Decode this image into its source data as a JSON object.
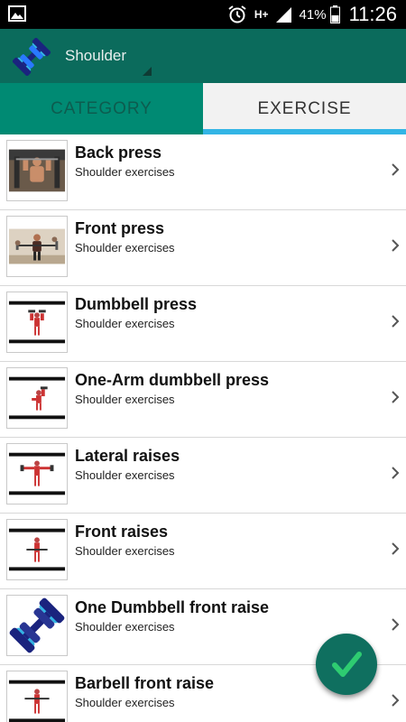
{
  "status_bar": {
    "network": "H+",
    "battery_percent": "41%",
    "time": "11:26",
    "icons": [
      "gallery-icon",
      "alarm-icon",
      "signal-icon",
      "battery-icon"
    ]
  },
  "app_bar": {
    "selected_category": "Shoulder",
    "logo_icon": "dumbbell-logo-icon",
    "color": "#0b6b5c"
  },
  "tabs": [
    {
      "label": "CATEGORY",
      "selected": false
    },
    {
      "label": "EXERCISE",
      "selected": true
    }
  ],
  "exercises": [
    {
      "title": "Back press",
      "subtitle": "Shoulder exercises",
      "thumb": "photo-gym"
    },
    {
      "title": "Front press",
      "subtitle": "Shoulder exercises",
      "thumb": "photo-barbell"
    },
    {
      "title": "Dumbbell press",
      "subtitle": "Shoulder exercises",
      "thumb": "figure-dumbbell-press"
    },
    {
      "title": "One-Arm dumbbell press",
      "subtitle": "Shoulder exercises",
      "thumb": "figure-one-arm-press"
    },
    {
      "title": "Lateral raises",
      "subtitle": "Shoulder exercises",
      "thumb": "figure-lateral-raise"
    },
    {
      "title": "Front raises",
      "subtitle": "Shoulder exercises",
      "thumb": "figure-front-raise"
    },
    {
      "title": "One Dumbbell front raise",
      "subtitle": "Shoulder exercises",
      "thumb": "dumbbell-logo"
    },
    {
      "title": "Barbell front raise",
      "subtitle": "Shoulder exercises",
      "thumb": "figure-barbell-raise"
    }
  ],
  "fab": {
    "icon": "checkmark-icon",
    "color": "#0f6f5f",
    "accent": "#2ecc71"
  },
  "colors": {
    "tab_indicator": "#33b5e5",
    "category_tab": "#008a73"
  }
}
